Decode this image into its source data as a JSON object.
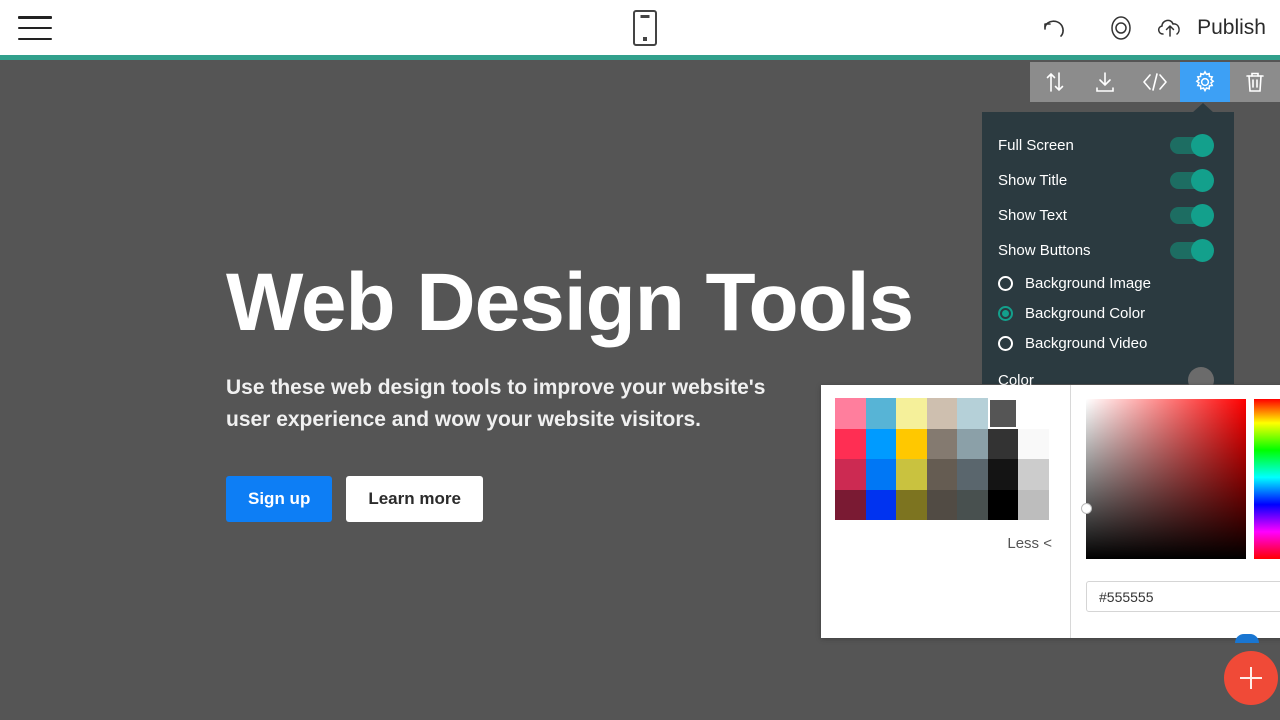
{
  "header": {
    "menu_icon": "hamburger-icon",
    "device_icon": "mobile-device-icon",
    "undo_icon": "undo-icon",
    "preview_icon": "eye-preview-icon",
    "publish_icon": "cloud-upload-icon",
    "publish_label": "Publish"
  },
  "accent": {
    "teal": "#31a08c",
    "blue": "#3da0f5",
    "red": "#f04a37",
    "panel_bg": "#2b3a40",
    "canvas_bg": "#555555"
  },
  "toolbar": {
    "move_icon": "move-updown-icon",
    "download_icon": "download-icon",
    "code_icon": "code-brackets-icon",
    "settings_icon": "gear-icon",
    "delete_icon": "trash-icon",
    "active": "gear-icon"
  },
  "hero": {
    "title": "Web Design Tools",
    "subtitle": "Use these web design tools to improve your website's user experience and wow your website visitors.",
    "primary_button": "Sign up",
    "secondary_button": "Learn more"
  },
  "settings": {
    "toggles": [
      {
        "label": "Full Screen",
        "on": true
      },
      {
        "label": "Show Title",
        "on": true
      },
      {
        "label": "Show Text",
        "on": true
      },
      {
        "label": "Show Buttons",
        "on": true
      }
    ],
    "radios": [
      {
        "label": "Background Image",
        "selected": false
      },
      {
        "label": "Background Color",
        "selected": true
      },
      {
        "label": "Background Video",
        "selected": false
      }
    ],
    "color_label": "Color",
    "color_value": "#6b6b6b"
  },
  "color_picker": {
    "less_label": "Less <",
    "hex_value": "#555555",
    "selected_swatch_index": 5,
    "swatches": [
      "#ff7e9d",
      "#57b4d6",
      "#f5f09a",
      "#cebfaf",
      "#b5d0d8",
      "#555555",
      "#ffffff",
      "#ff2e53",
      "#009bff",
      "#ffc800",
      "#847a70",
      "#8ba0a8",
      "#333333",
      "#f9f9f9",
      "#cc2a52",
      "#0077f5",
      "#c9c23f",
      "#655c52",
      "#5a666d",
      "#141414",
      "#cccccc",
      "#7a1a33",
      "#0033f0",
      "#7d7420",
      "#514b44",
      "#48504f",
      "#000000",
      "#bdbdbd"
    ]
  },
  "fab": {
    "label": "add-block-button",
    "icon": "plus-icon"
  }
}
